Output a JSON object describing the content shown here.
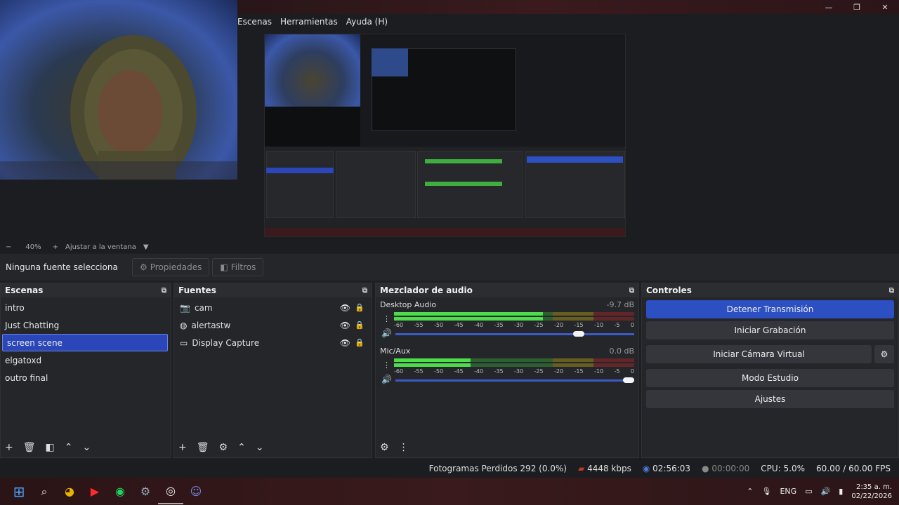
{
  "menubar": {
    "items": [
      "Escenas",
      "Herramientas",
      "Ayuda (H)"
    ]
  },
  "window_controls": {
    "minimize": "—",
    "restore": "❐",
    "close": "✕"
  },
  "zoom": {
    "minus": "−",
    "value": "40%",
    "plus": "+",
    "fit": "Ajustar a la ventana"
  },
  "properties_bar": {
    "no_selection": "Ninguna fuente selecciona",
    "properties": "Propiedades",
    "filters": "Filtros"
  },
  "scenes": {
    "title": "Escenas",
    "items": [
      "intro",
      "Just Chatting",
      "screen scene",
      "elgatoxd",
      "outro final"
    ],
    "selected": "screen scene"
  },
  "sources": {
    "title": "Fuentes",
    "items": [
      {
        "label": "cam",
        "icon": "camera-icon"
      },
      {
        "label": "alertastw",
        "icon": "globe-icon"
      },
      {
        "label": "Display Capture",
        "icon": "monitor-icon"
      }
    ]
  },
  "mixer": {
    "title": "Mezclador de audio",
    "ticks": [
      "-60",
      "-55",
      "-50",
      "-45",
      "-40",
      "-35",
      "-30",
      "-25",
      "-20",
      "-15",
      "-10",
      "-5",
      "0"
    ],
    "tracks": [
      {
        "name": "Desktop Audio",
        "db": "-9.7 dB",
        "level": 0.62,
        "volume": 0.79
      },
      {
        "name": "Mic/Aux",
        "db": "0.0 dB",
        "level": 0.32,
        "volume": 1.0
      }
    ]
  },
  "controls": {
    "title": "Controles",
    "buttons": [
      "Detener Transmisión",
      "Iniciar Grabación",
      "Iniciar Cámara Virtual",
      "Modo Estudio",
      "Ajustes"
    ]
  },
  "status": {
    "dropped": "Fotogramas Perdidos 292 (0.0%)",
    "kbps": "4448 kbps",
    "stream_time": "02:56:03",
    "rec_time": "00:00:00",
    "cpu": "CPU: 5.0%",
    "fps": "60.00 / 60.00 FPS"
  },
  "taskbar": {
    "lang": "ENG",
    "time": "2:35 a. m.",
    "date": "02/22/2026"
  },
  "colors": {
    "accent": "#2c4fc2",
    "selected_scene": "#2a46b8"
  }
}
